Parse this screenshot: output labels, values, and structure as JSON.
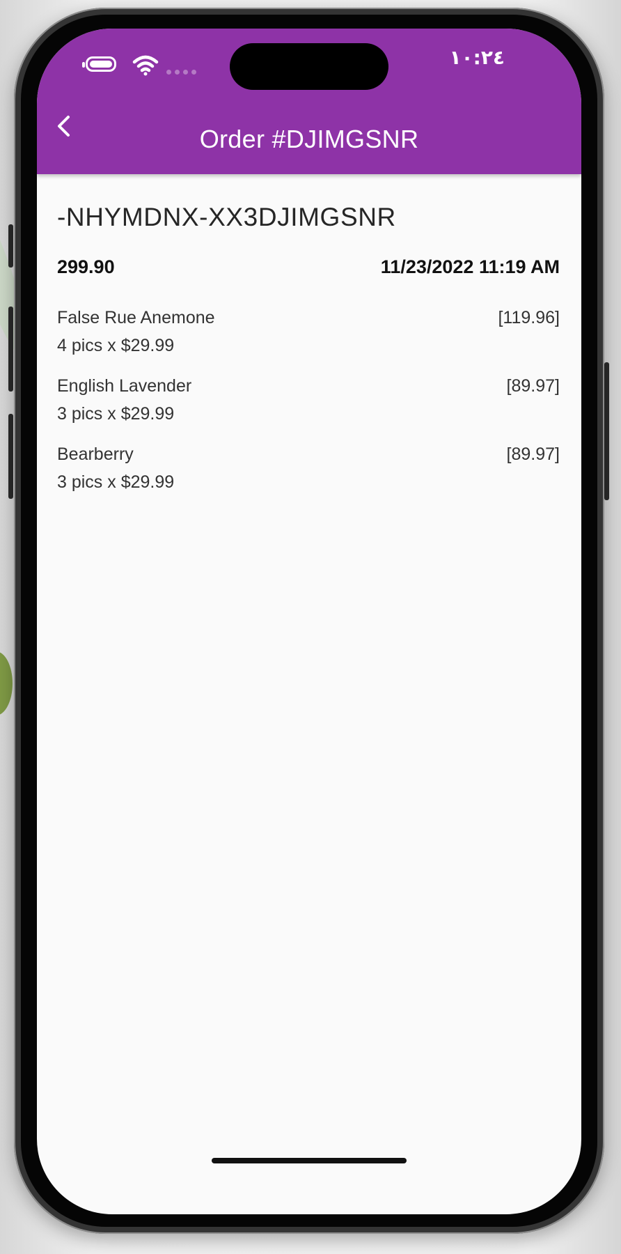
{
  "status_bar": {
    "time": "١٠:٢٤",
    "battery_icon": "battery-icon",
    "wifi_icon": "wifi-icon",
    "cellular_icon": "cellular-signal-icon"
  },
  "app_bar": {
    "title": "Order #DJIMGSNR",
    "back_icon": "chevron-left-icon",
    "color": "#8e33a7"
  },
  "order": {
    "code": "-NHYMDNX-XX3DJIMGSNR",
    "total": "299.90",
    "date": "11/23/2022 11:19 AM",
    "items": [
      {
        "name": "False Rue Anemone",
        "qty": "4 pics x $29.99",
        "total": "[119.96]"
      },
      {
        "name": "English Lavender",
        "qty": "3 pics x $29.99",
        "total": "[89.97]"
      },
      {
        "name": "Bearberry",
        "qty": "3 pics x $29.99",
        "total": "[89.97]"
      }
    ]
  }
}
